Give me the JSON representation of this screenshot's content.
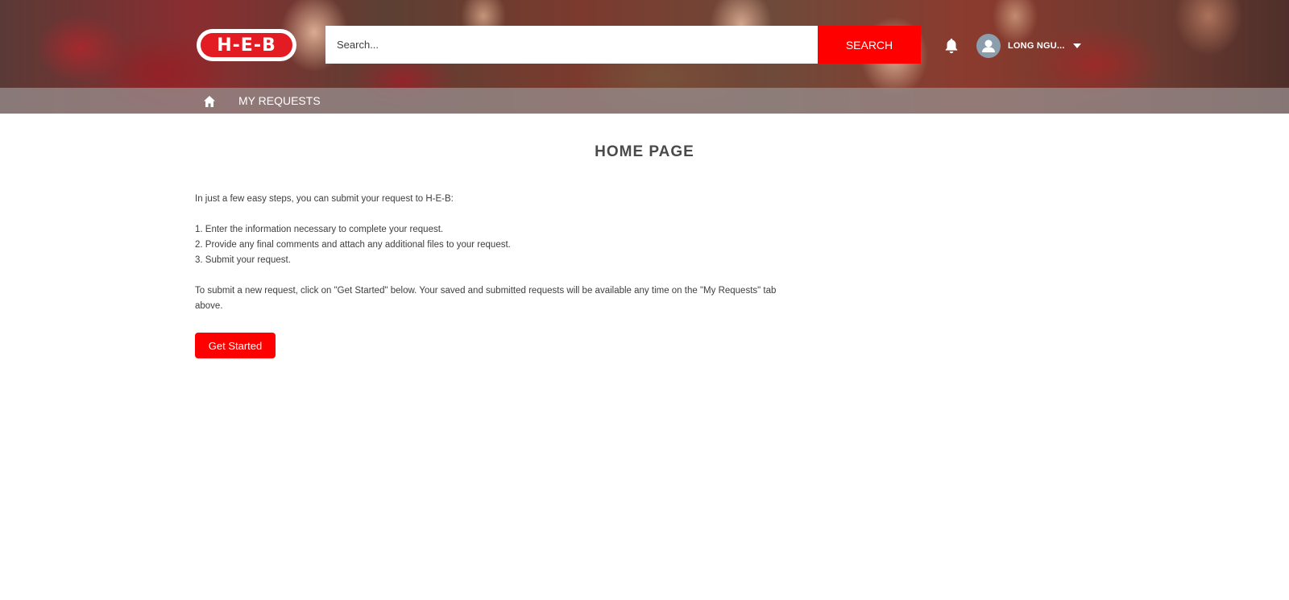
{
  "brand": {
    "logo_text": "H-E-B",
    "accent_color": "#ff0000"
  },
  "search": {
    "placeholder": "Search...",
    "button_label": "SEARCH"
  },
  "header": {
    "notification_icon": "bell-icon",
    "user_name": "LONG NGU...",
    "user_icon": "user-avatar-icon",
    "menu_icon": "chevron-down-icon"
  },
  "nav": {
    "home_icon": "home-icon",
    "items": [
      {
        "label": "MY REQUESTS"
      }
    ]
  },
  "main": {
    "title": "HOME PAGE",
    "intro": "In just a few easy steps, you can submit your request to H-E-B:",
    "steps": [
      "1. Enter the information necessary to complete your request.",
      "2. Provide any final comments and attach any additional files to your request.",
      "3. Submit your request."
    ],
    "instructions": "To submit a new request, click on \"Get Started\" below. Your saved and submitted requests will be available any time on the \"My Requests\" tab above.",
    "cta_label": "Get Started"
  }
}
